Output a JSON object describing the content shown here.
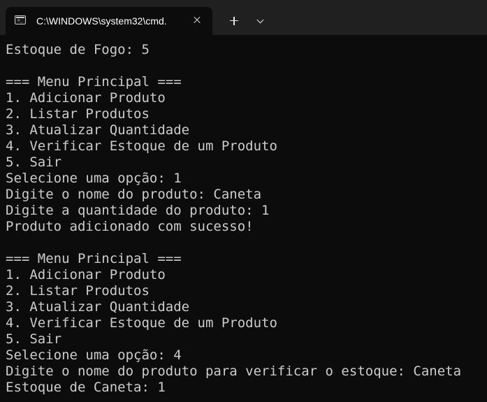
{
  "window": {
    "tab_title": "C:\\WINDOWS\\system32\\cmd.",
    "tab_icon": "terminal-icon",
    "tab_icon_prompt": ">_"
  },
  "colors": {
    "titlebar": "#202020",
    "console_bg": "#0c0c0c",
    "console_text": "#cccccc"
  },
  "console": {
    "lines": [
      "Estoque de Fogo: 5",
      "",
      "=== Menu Principal ===",
      "1. Adicionar Produto",
      "2. Listar Produtos",
      "3. Atualizar Quantidade",
      "4. Verificar Estoque de um Produto",
      "5. Sair",
      "Selecione uma opção: 1",
      "Digite o nome do produto: Caneta",
      "Digite a quantidade do produto: 1",
      "Produto adicionado com sucesso!",
      "",
      "=== Menu Principal ===",
      "1. Adicionar Produto",
      "2. Listar Produtos",
      "3. Atualizar Quantidade",
      "4. Verificar Estoque de um Produto",
      "5. Sair",
      "Selecione uma opção: 4",
      "Digite o nome do produto para verificar o estoque: Caneta",
      "Estoque de Caneta: 1"
    ]
  }
}
